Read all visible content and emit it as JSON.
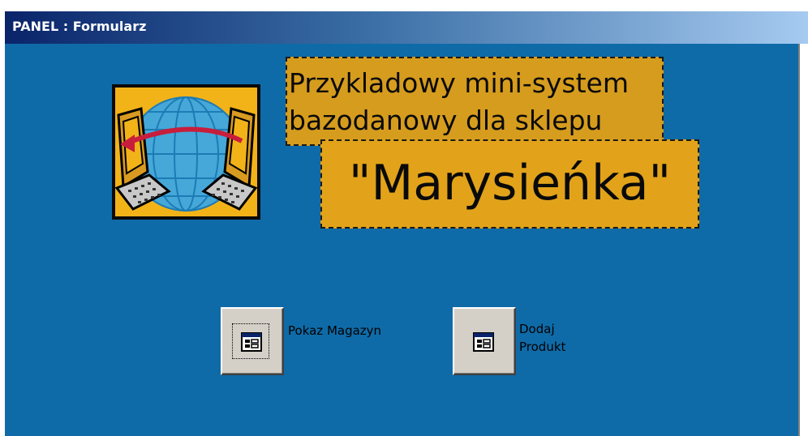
{
  "window": {
    "title": "PANEL : Formularz"
  },
  "header": {
    "subtitle_line1": "Przykladowy mini-system",
    "subtitle_line2": "bazodanowy dla sklepu",
    "shop_name": "\"Marysieńka\""
  },
  "buttons": [
    {
      "caption": "Pokaz Magazyn",
      "icon": "form-icon",
      "focused": true
    },
    {
      "caption_line1": "Dodaj",
      "caption_line2": "Produkt",
      "icon": "form-icon",
      "focused": false
    }
  ],
  "logo": {
    "icon": "network-computers-globe-icon"
  },
  "colors": {
    "background": "#0f6ba8",
    "subtitle_fill": "#d69c1e",
    "shop_name_fill": "#e2a31a",
    "button_face": "#d4d0c8",
    "title_gradient_start": "#0a246a",
    "title_gradient_end": "#a6caf0"
  }
}
